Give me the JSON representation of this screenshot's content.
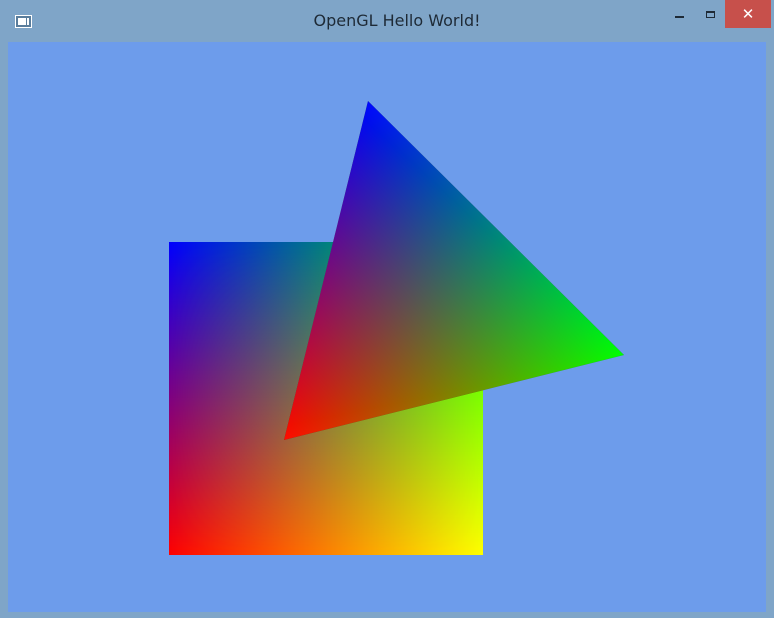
{
  "window": {
    "title": "OpenGL Hello World!",
    "frame_color": "#7fa5c8",
    "close_button_color": "#c7504b",
    "icons": {
      "app": "app-window-icon",
      "minimize": "minimize-icon",
      "maximize": "maximize-icon",
      "close": "close-icon"
    },
    "close_glyph": "✕"
  },
  "scene": {
    "clear_color": "#6d9ceb",
    "square": {
      "corner_colors": {
        "top_left": "#0000ff",
        "top_right": "#00ff00",
        "bottom_left": "#ff0000",
        "bottom_right": "#ffff00"
      }
    },
    "triangle": {
      "vertex_colors": {
        "top": "#0000ff",
        "right": "#00ff00",
        "bottom_left": "#ff0000"
      }
    }
  }
}
